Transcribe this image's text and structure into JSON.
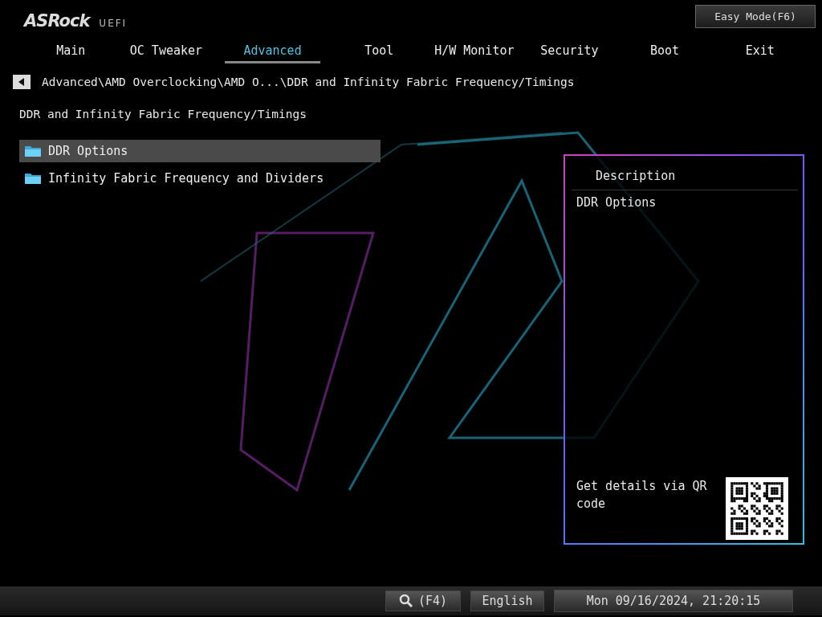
{
  "header": {
    "logo": "ASRock",
    "logo_suffix": "UEFI",
    "mode_button": "Easy Mode(F6)"
  },
  "tabs": [
    {
      "label": "Main",
      "selected": false
    },
    {
      "label": "OC Tweaker",
      "selected": false
    },
    {
      "label": "Advanced",
      "selected": true
    },
    {
      "label": "Tool",
      "selected": false
    },
    {
      "label": "H/W Monitor",
      "selected": false
    },
    {
      "label": "Security",
      "selected": false
    },
    {
      "label": "Boot",
      "selected": false
    },
    {
      "label": "Exit",
      "selected": false
    }
  ],
  "breadcrumb": "Advanced\\AMD Overclocking\\AMD O...\\DDR and Infinity Fabric Frequency/Timings",
  "page_title": "DDR and Infinity Fabric Frequency/Timings",
  "items": [
    {
      "label": "DDR Options",
      "selected": true
    },
    {
      "label": "Infinity Fabric Frequency and Dividers",
      "selected": false
    }
  ],
  "description": {
    "heading": "Description",
    "text": "DDR Options",
    "qr_text": "Get details via QR code"
  },
  "status_bar": {
    "search_key": "(F4)",
    "language": "English",
    "datetime": "Mon 09/16/2024, 21:20:15"
  }
}
